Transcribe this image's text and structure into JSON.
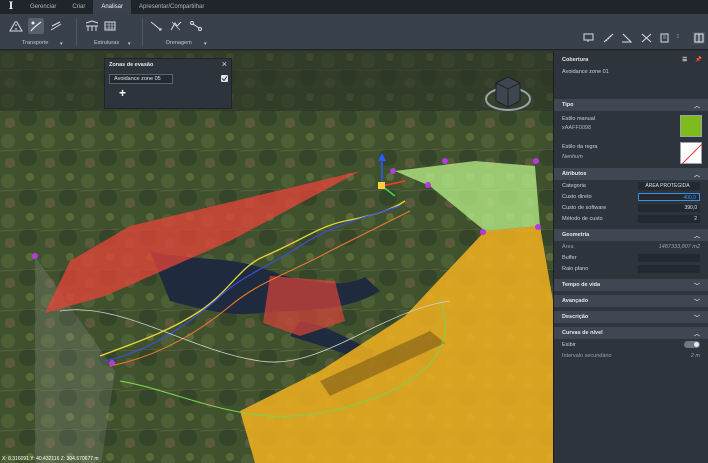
{
  "app": {
    "logo": "I"
  },
  "tabs": [
    "Gerenciar",
    "Criar",
    "Analisar",
    "Apresentar/Compartilhar"
  ],
  "active_tab": "Analisar",
  "ribbon": {
    "groups": [
      {
        "label": "Transporte"
      },
      {
        "label": "Estruturas"
      },
      {
        "label": "Drenagem"
      }
    ]
  },
  "dialog": {
    "title": "Zonas de evasão",
    "item": "Avoidance zone 05",
    "add": "+"
  },
  "panel": {
    "title": "Cobertura",
    "subtitle": "Avoidance zone 01",
    "tipo": {
      "header": "Tipo",
      "manual_label": "Estilo manual",
      "manual_value": "xAAFF0098",
      "rule_label": "Estilo da regra",
      "rule_value": "Nenhum",
      "manual_color": "#7dbb1f"
    },
    "atributos": {
      "header": "Atributos",
      "rows": [
        {
          "label": "Categoria",
          "value": "ÁREA PROTEGIDA"
        },
        {
          "label": "Custo direto",
          "value": "400,0"
        },
        {
          "label": "Custo de software",
          "value": "390,0"
        },
        {
          "label": "Método de custo",
          "value": "2"
        }
      ]
    },
    "geometria": {
      "header": "Geometria",
      "area_label": "Área",
      "area_value": "1487333,807",
      "area_unit": "m2",
      "buffer_label": "Buffer",
      "raio_label": "Raio plano"
    },
    "collapsed": [
      "Tempo de vida",
      "Avançado",
      "Descrição"
    ],
    "curvas": {
      "header": "Curvas de nível",
      "exibir_label": "Exibir",
      "intervalo_label": "Intervalo secundário",
      "intervalo_value": "2",
      "intervalo_unit": "m"
    }
  },
  "status": {
    "coordinates": "X: 8.316091 Y: 40.432116 Z: 304.670677 m"
  }
}
